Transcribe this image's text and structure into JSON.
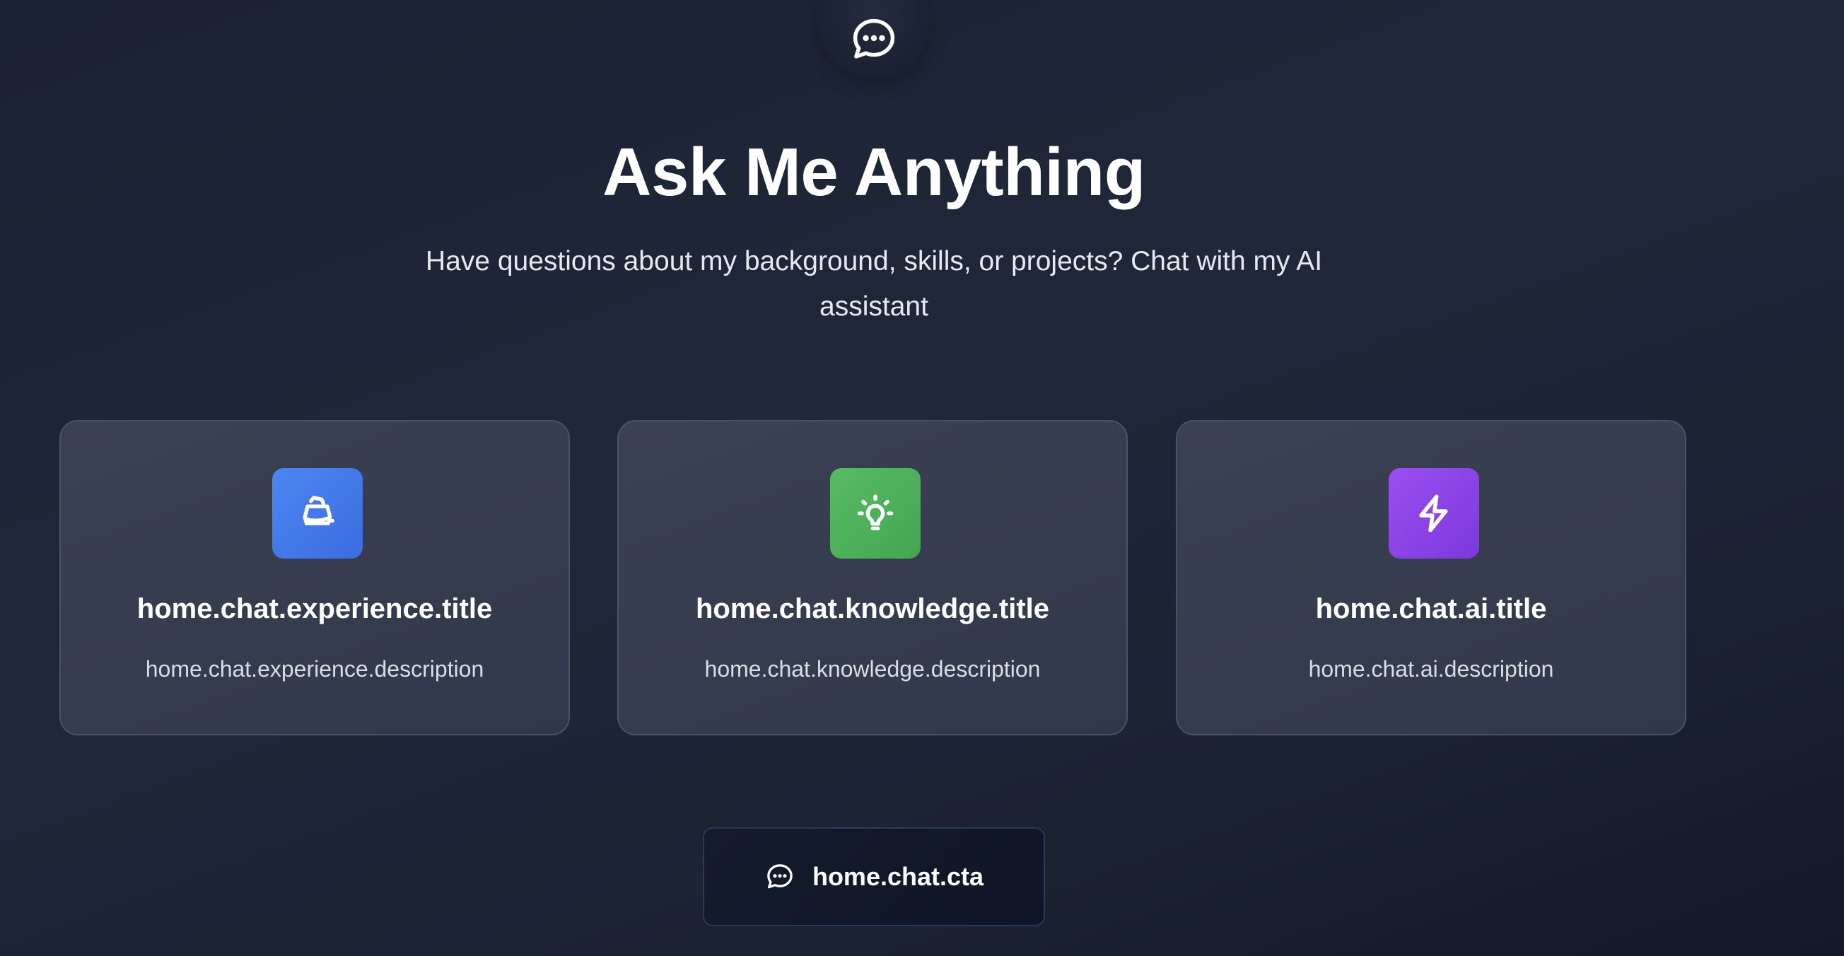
{
  "hero": {
    "icon": "chat-bubble-icon",
    "title": "Ask Me Anything",
    "subtitle": "Have questions about my background, skills, or projects? Chat with my AI assistant"
  },
  "cards": [
    {
      "icon": "briefcase-icon",
      "icon_color": "#4479eb",
      "title": "home.chat.experience.title",
      "description": "home.chat.experience.description"
    },
    {
      "icon": "lightbulb-icon",
      "icon_color": "#4daf5a",
      "title": "home.chat.knowledge.title",
      "description": "home.chat.knowledge.description"
    },
    {
      "icon": "lightning-icon",
      "icon_color": "#8b43e6",
      "title": "home.chat.ai.title",
      "description": "home.chat.ai.description"
    }
  ],
  "cta": {
    "icon": "chat-bubble-icon",
    "label": "home.chat.cta"
  }
}
